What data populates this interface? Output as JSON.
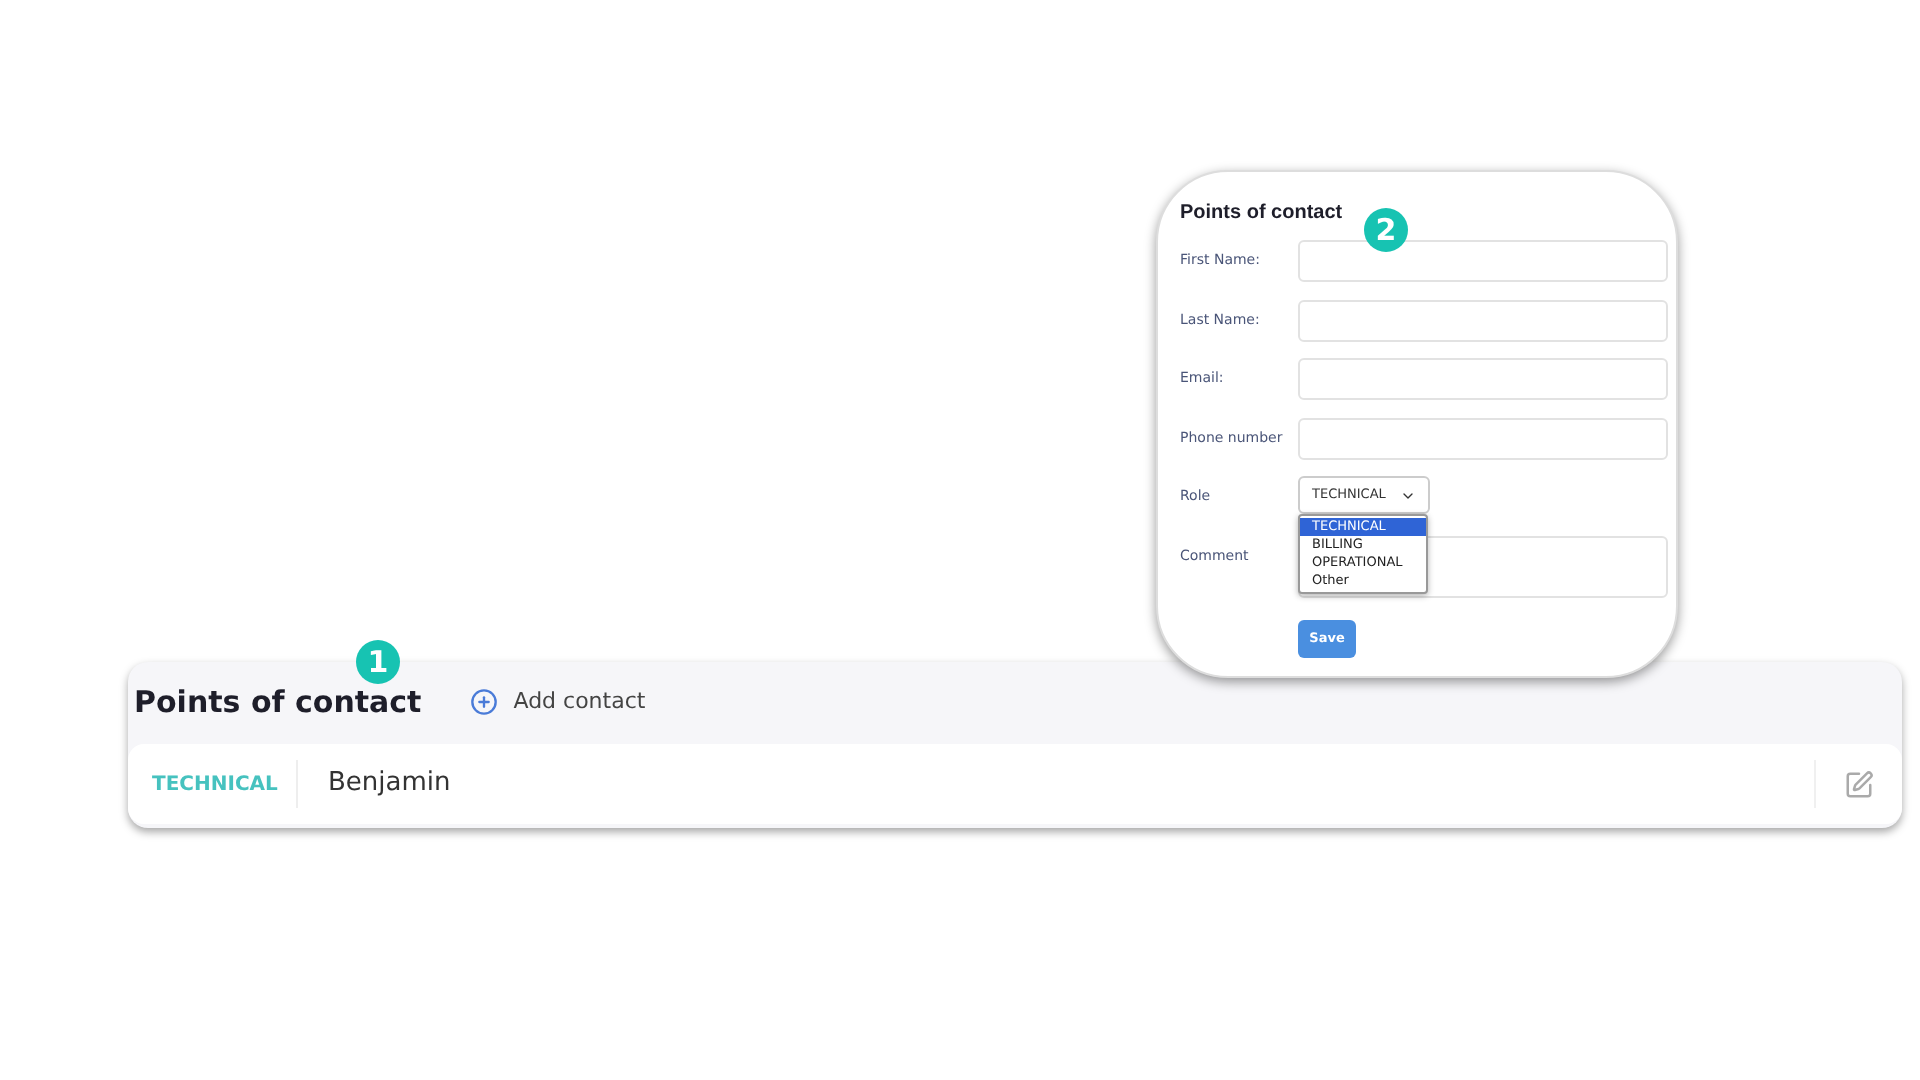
{
  "card": {
    "title": "Points of contact",
    "step": "1",
    "add_button": "Add contact",
    "contacts": [
      {
        "role": "TECHNICAL",
        "name": "Benjamin"
      }
    ]
  },
  "form": {
    "title": "Points of contact",
    "step": "2",
    "fields": [
      {
        "kind": "text",
        "label": "First Name:"
      },
      {
        "kind": "text",
        "label": "Last Name:"
      },
      {
        "kind": "text",
        "label": "Email:"
      },
      {
        "kind": "text",
        "label": "Phone number"
      },
      {
        "kind": "select",
        "label": "Role",
        "value": "TECHNICAL",
        "options": [
          {
            "label": "TECHNICAL",
            "selected": true
          },
          {
            "label": "BILLING",
            "selected": false
          },
          {
            "label": "OPERATIONAL",
            "selected": false
          },
          {
            "label": "Other",
            "selected": false
          }
        ]
      },
      {
        "kind": "textarea",
        "label": "Comment"
      }
    ],
    "save": "Save"
  }
}
